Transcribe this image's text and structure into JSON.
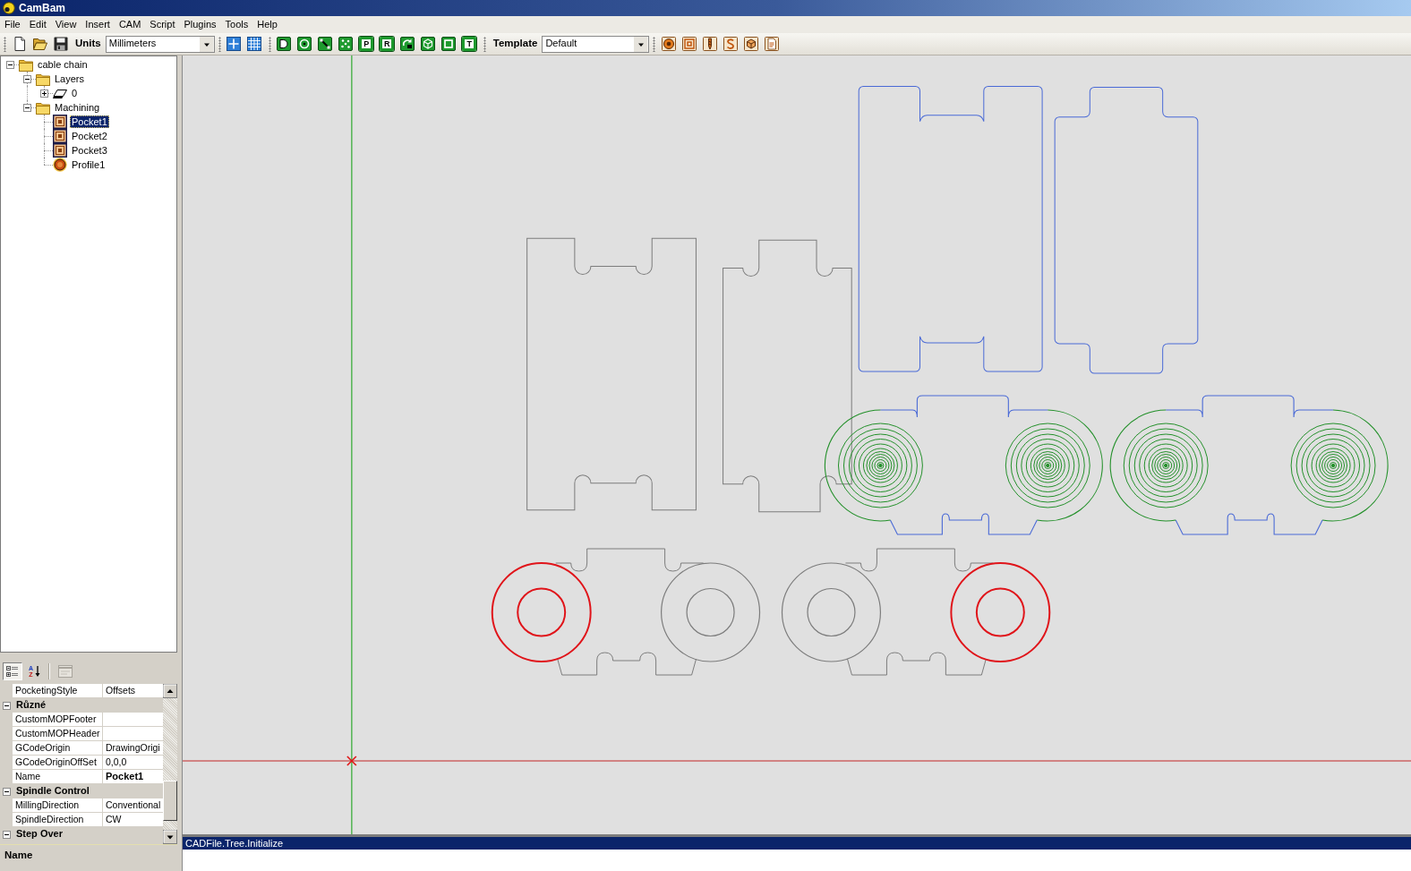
{
  "window": {
    "title": "CamBam"
  },
  "menu": [
    "File",
    "Edit",
    "View",
    "Insert",
    "CAM",
    "Script",
    "Plugins",
    "Tools",
    "Help"
  ],
  "toolbar": {
    "file_tools": [
      {
        "kind": "new"
      },
      {
        "kind": "open"
      },
      {
        "kind": "save"
      }
    ],
    "units": {
      "label": "Units",
      "value": "Millimeters"
    },
    "view_tools": [
      {
        "kind": "snap"
      },
      {
        "kind": "grid"
      }
    ],
    "draw_tools": [
      {
        "kind": "arc"
      },
      {
        "kind": "circle"
      },
      {
        "kind": "line"
      },
      {
        "kind": "points"
      },
      {
        "kind": "letter",
        "glyph": "P"
      },
      {
        "kind": "letter",
        "glyph": "R"
      },
      {
        "kind": "rotate"
      },
      {
        "kind": "cube"
      },
      {
        "kind": "square"
      },
      {
        "kind": "letter",
        "glyph": "T"
      }
    ],
    "template": {
      "label": "Template",
      "value": "Default"
    },
    "cam_tools": [
      {
        "kind": "profile"
      },
      {
        "kind": "pocket"
      },
      {
        "kind": "drill"
      },
      {
        "kind": "engrave"
      },
      {
        "kind": "solid"
      },
      {
        "kind": "gcode"
      }
    ]
  },
  "tree": [
    {
      "label": "cable chain",
      "kind": "folder",
      "expanded": true,
      "selected": false,
      "children": [
        {
          "label": "Layers",
          "kind": "folder",
          "expanded": true,
          "selected": false,
          "children": [
            {
              "label": "0",
              "kind": "layer",
              "expanded": false,
              "selected": false
            }
          ]
        },
        {
          "label": "Machining",
          "kind": "folder",
          "expanded": true,
          "selected": false,
          "children": [
            {
              "label": "Pocket1",
              "kind": "pocket",
              "selected": true
            },
            {
              "label": "Pocket2",
              "kind": "pocket",
              "selected": false
            },
            {
              "label": "Pocket3",
              "kind": "pocket",
              "selected": false
            },
            {
              "label": "Profile1",
              "kind": "profile",
              "selected": false
            }
          ]
        }
      ]
    }
  ],
  "properties": {
    "toolbar": [
      {
        "kind": "categorized",
        "selected": true,
        "disabled": false
      },
      {
        "kind": "alphabetical",
        "glyph": "AZ",
        "selected": false,
        "disabled": false
      },
      {
        "kind": "pages",
        "selected": false,
        "disabled": true
      }
    ],
    "rows": [
      {
        "kind": "property",
        "name": "PocketingStyle",
        "value": "Offsets",
        "modified": false
      },
      {
        "kind": "category",
        "name": "Různé",
        "expanded": true
      },
      {
        "kind": "property",
        "name": "CustomMOPFooter"
      },
      {
        "kind": "property",
        "name": "CustomMOPHeader"
      },
      {
        "kind": "property",
        "name": "GCodeOrigin",
        "value": "DrawingOrigi",
        "modified": false
      },
      {
        "kind": "property",
        "name": "GCodeOriginOffSet",
        "value": "0,0,0",
        "modified": false
      },
      {
        "kind": "property",
        "name": "Name",
        "value": "Pocket1",
        "modified": true
      },
      {
        "kind": "category",
        "name": "Spindle Control",
        "expanded": true
      },
      {
        "kind": "property",
        "name": "MillingDirection",
        "value": "Conventional",
        "modified": false
      },
      {
        "kind": "property",
        "name": "SpindleDirection",
        "value": "CW",
        "modified": false
      },
      {
        "kind": "category",
        "name": "Step Over",
        "expanded": true
      }
    ],
    "description_title": "Name"
  },
  "log": [
    {
      "text": "CADFile.Tree.Initialize",
      "selected": true
    }
  ]
}
